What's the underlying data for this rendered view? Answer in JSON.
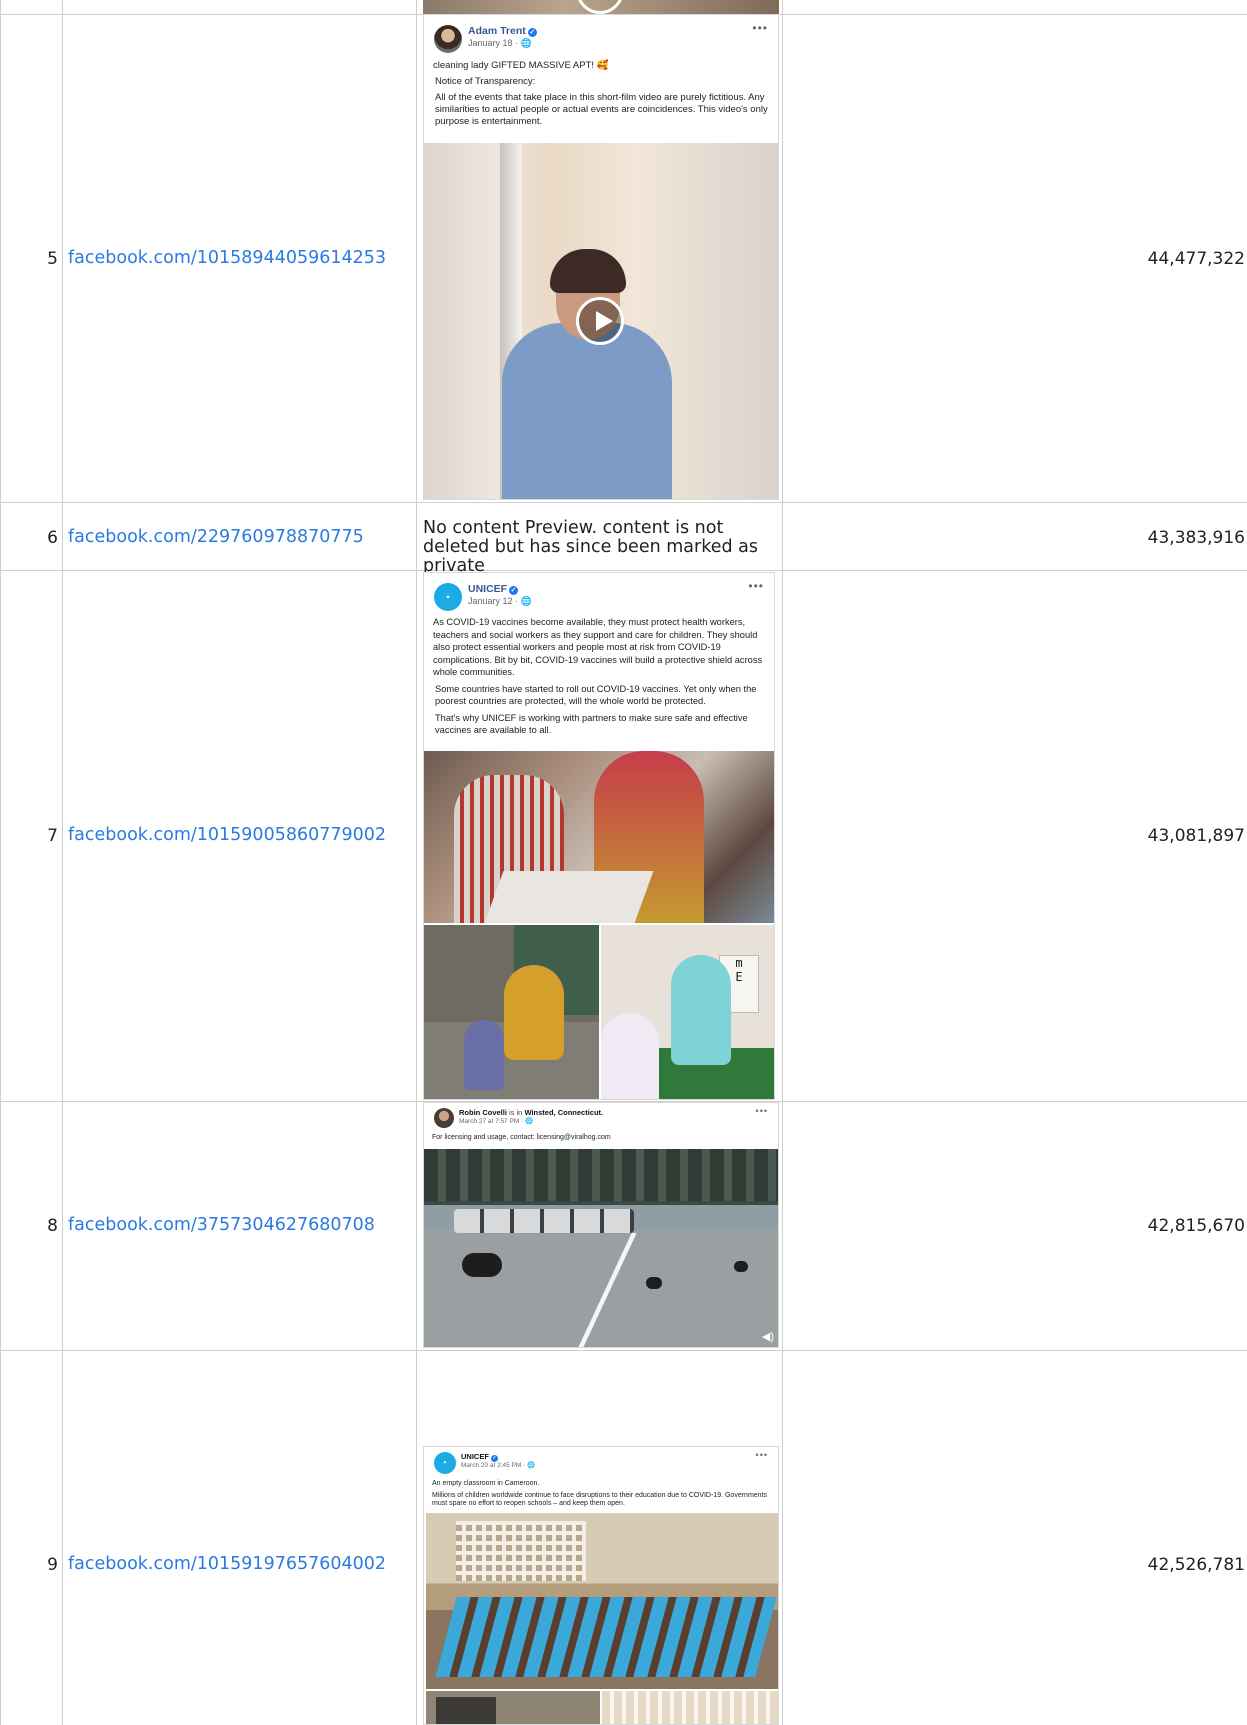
{
  "rows": [
    {
      "rank": "5",
      "link": "facebook.com/10158944059614253",
      "views": "44,477,322"
    },
    {
      "rank": "6",
      "link": "facebook.com/229760978870775",
      "views": "43,383,916"
    },
    {
      "rank": "7",
      "link": "facebook.com/10159005860779002",
      "views": "43,081,897"
    },
    {
      "rank": "8",
      "link": "facebook.com/3757304627680708",
      "views": "42,815,670"
    },
    {
      "rank": "9",
      "link": "facebook.com/10159197657604002",
      "views": "42,526,781"
    }
  ],
  "no_preview_text": "No content Preview. content is not deleted but has since been marked as private",
  "posts": {
    "adam": {
      "author": "Adam Trent",
      "date": "January 18 · 🌐",
      "lines": [
        "cleaning lady GIFTED MASSIVE APT! 🥰",
        "Notice of Transparency:",
        "All of the events that take place in this short-film video are purely fictitious. Any similarities to actual people or actual events are coincidences. This video's only purpose is entertainment."
      ]
    },
    "unicef1": {
      "author": "UNICEF",
      "date": "January 12 · 🌐",
      "lines": [
        "As COVID-19 vaccines become available, they must protect health workers, teachers and social workers as they support and care for children. They should also protect essential workers and people most at risk from COVID-19 complications. Bit by bit, COVID-19 vaccines will build a protective shield across whole communities.",
        "Some countries have started to roll out COVID-19 vaccines. Yet only when the poorest countries are protected, will the whole world be protected.",
        "That's why UNICEF is working with partners to make sure safe and effective vaccines are available to all."
      ]
    },
    "robin": {
      "author": "Robin Covelli",
      "is_in": "is in",
      "place": "Winsted, Connecticut.",
      "date": "March 27 at 7:57 PM · 🌐",
      "lines": [
        "For licensing and usage, contact: licensing@viralhog.com"
      ]
    },
    "unicef2": {
      "author": "UNICEF",
      "date": "March 20 at 2:45 PM · 🌐",
      "lines": [
        "An empty classroom in Cameroon.",
        "Millions of children worldwide continue to face disruptions to their education due to COVID-19. Governments must spare no effort to reopen schools – and keep them open."
      ]
    }
  },
  "icons": {
    "more": "more-options-icon",
    "verified": "verified-badge-icon",
    "play": "play-icon",
    "speaker": "speaker-icon"
  },
  "colors": {
    "link": "#2a7ae2",
    "grid": "#cfcfcf",
    "fb_name": "#385898"
  }
}
